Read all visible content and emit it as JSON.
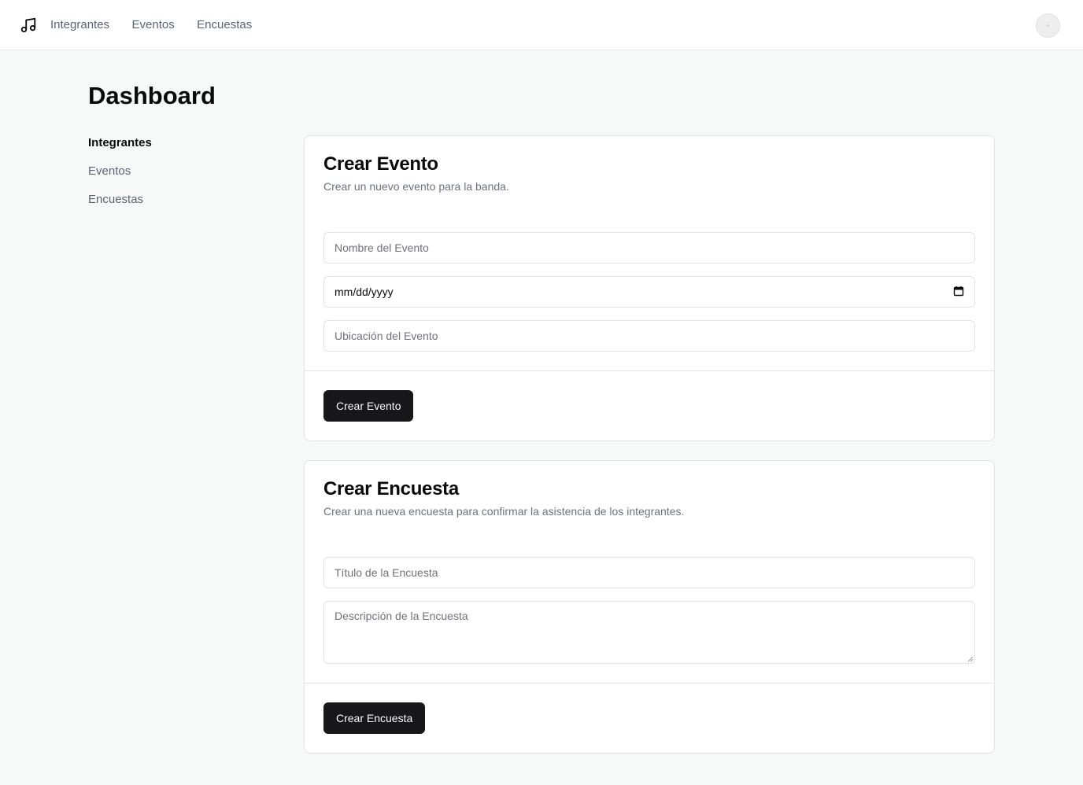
{
  "topnav": {
    "logo_icon": "music-note-icon",
    "items": [
      "Integrantes",
      "Eventos",
      "Encuestas"
    ]
  },
  "page": {
    "title": "Dashboard"
  },
  "sidenav": {
    "items": [
      {
        "label": "Integrantes",
        "active": true
      },
      {
        "label": "Eventos",
        "active": false
      },
      {
        "label": "Encuestas",
        "active": false
      }
    ]
  },
  "event_card": {
    "title": "Crear Evento",
    "description": "Crear un nuevo evento para la banda.",
    "name_placeholder": "Nombre del Evento",
    "date_value": "mm/dd/yyyy",
    "location_placeholder": "Ubicación del Evento",
    "submit_label": "Crear Evento"
  },
  "poll_card": {
    "title": "Crear Encuesta",
    "description": "Crear una nueva encuesta para confirmar la asistencia de los integrantes.",
    "title_placeholder": "Título de la Encuesta",
    "description_placeholder": "Descripción de la Encuesta",
    "submit_label": "Crear Encuesta"
  },
  "colors": {
    "button_bg": "#18181b",
    "page_bg": "#f7f8f8",
    "muted_text": "#5b6472"
  }
}
